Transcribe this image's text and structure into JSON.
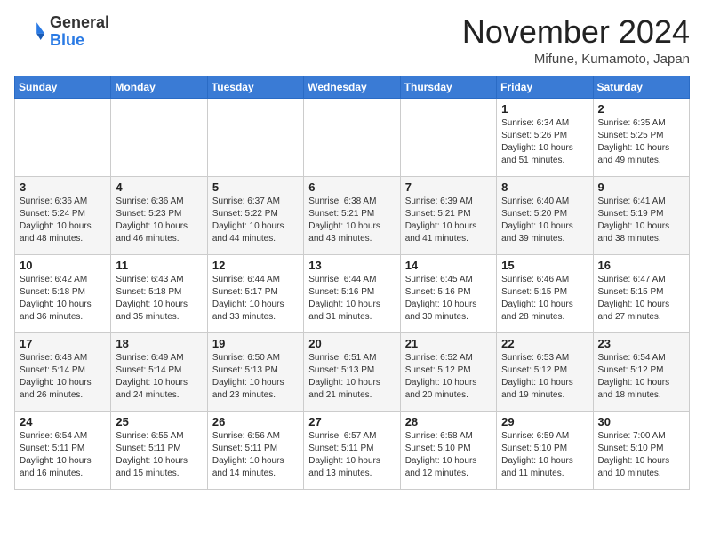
{
  "header": {
    "logo_line1": "General",
    "logo_line2": "Blue",
    "month": "November 2024",
    "location": "Mifune, Kumamoto, Japan"
  },
  "days_of_week": [
    "Sunday",
    "Monday",
    "Tuesday",
    "Wednesday",
    "Thursday",
    "Friday",
    "Saturday"
  ],
  "weeks": [
    [
      {
        "day": "",
        "info": ""
      },
      {
        "day": "",
        "info": ""
      },
      {
        "day": "",
        "info": ""
      },
      {
        "day": "",
        "info": ""
      },
      {
        "day": "",
        "info": ""
      },
      {
        "day": "1",
        "info": "Sunrise: 6:34 AM\nSunset: 5:26 PM\nDaylight: 10 hours\nand 51 minutes."
      },
      {
        "day": "2",
        "info": "Sunrise: 6:35 AM\nSunset: 5:25 PM\nDaylight: 10 hours\nand 49 minutes."
      }
    ],
    [
      {
        "day": "3",
        "info": "Sunrise: 6:36 AM\nSunset: 5:24 PM\nDaylight: 10 hours\nand 48 minutes."
      },
      {
        "day": "4",
        "info": "Sunrise: 6:36 AM\nSunset: 5:23 PM\nDaylight: 10 hours\nand 46 minutes."
      },
      {
        "day": "5",
        "info": "Sunrise: 6:37 AM\nSunset: 5:22 PM\nDaylight: 10 hours\nand 44 minutes."
      },
      {
        "day": "6",
        "info": "Sunrise: 6:38 AM\nSunset: 5:21 PM\nDaylight: 10 hours\nand 43 minutes."
      },
      {
        "day": "7",
        "info": "Sunrise: 6:39 AM\nSunset: 5:21 PM\nDaylight: 10 hours\nand 41 minutes."
      },
      {
        "day": "8",
        "info": "Sunrise: 6:40 AM\nSunset: 5:20 PM\nDaylight: 10 hours\nand 39 minutes."
      },
      {
        "day": "9",
        "info": "Sunrise: 6:41 AM\nSunset: 5:19 PM\nDaylight: 10 hours\nand 38 minutes."
      }
    ],
    [
      {
        "day": "10",
        "info": "Sunrise: 6:42 AM\nSunset: 5:18 PM\nDaylight: 10 hours\nand 36 minutes."
      },
      {
        "day": "11",
        "info": "Sunrise: 6:43 AM\nSunset: 5:18 PM\nDaylight: 10 hours\nand 35 minutes."
      },
      {
        "day": "12",
        "info": "Sunrise: 6:44 AM\nSunset: 5:17 PM\nDaylight: 10 hours\nand 33 minutes."
      },
      {
        "day": "13",
        "info": "Sunrise: 6:44 AM\nSunset: 5:16 PM\nDaylight: 10 hours\nand 31 minutes."
      },
      {
        "day": "14",
        "info": "Sunrise: 6:45 AM\nSunset: 5:16 PM\nDaylight: 10 hours\nand 30 minutes."
      },
      {
        "day": "15",
        "info": "Sunrise: 6:46 AM\nSunset: 5:15 PM\nDaylight: 10 hours\nand 28 minutes."
      },
      {
        "day": "16",
        "info": "Sunrise: 6:47 AM\nSunset: 5:15 PM\nDaylight: 10 hours\nand 27 minutes."
      }
    ],
    [
      {
        "day": "17",
        "info": "Sunrise: 6:48 AM\nSunset: 5:14 PM\nDaylight: 10 hours\nand 26 minutes."
      },
      {
        "day": "18",
        "info": "Sunrise: 6:49 AM\nSunset: 5:14 PM\nDaylight: 10 hours\nand 24 minutes."
      },
      {
        "day": "19",
        "info": "Sunrise: 6:50 AM\nSunset: 5:13 PM\nDaylight: 10 hours\nand 23 minutes."
      },
      {
        "day": "20",
        "info": "Sunrise: 6:51 AM\nSunset: 5:13 PM\nDaylight: 10 hours\nand 21 minutes."
      },
      {
        "day": "21",
        "info": "Sunrise: 6:52 AM\nSunset: 5:12 PM\nDaylight: 10 hours\nand 20 minutes."
      },
      {
        "day": "22",
        "info": "Sunrise: 6:53 AM\nSunset: 5:12 PM\nDaylight: 10 hours\nand 19 minutes."
      },
      {
        "day": "23",
        "info": "Sunrise: 6:54 AM\nSunset: 5:12 PM\nDaylight: 10 hours\nand 18 minutes."
      }
    ],
    [
      {
        "day": "24",
        "info": "Sunrise: 6:54 AM\nSunset: 5:11 PM\nDaylight: 10 hours\nand 16 minutes."
      },
      {
        "day": "25",
        "info": "Sunrise: 6:55 AM\nSunset: 5:11 PM\nDaylight: 10 hours\nand 15 minutes."
      },
      {
        "day": "26",
        "info": "Sunrise: 6:56 AM\nSunset: 5:11 PM\nDaylight: 10 hours\nand 14 minutes."
      },
      {
        "day": "27",
        "info": "Sunrise: 6:57 AM\nSunset: 5:11 PM\nDaylight: 10 hours\nand 13 minutes."
      },
      {
        "day": "28",
        "info": "Sunrise: 6:58 AM\nSunset: 5:10 PM\nDaylight: 10 hours\nand 12 minutes."
      },
      {
        "day": "29",
        "info": "Sunrise: 6:59 AM\nSunset: 5:10 PM\nDaylight: 10 hours\nand 11 minutes."
      },
      {
        "day": "30",
        "info": "Sunrise: 7:00 AM\nSunset: 5:10 PM\nDaylight: 10 hours\nand 10 minutes."
      }
    ]
  ]
}
